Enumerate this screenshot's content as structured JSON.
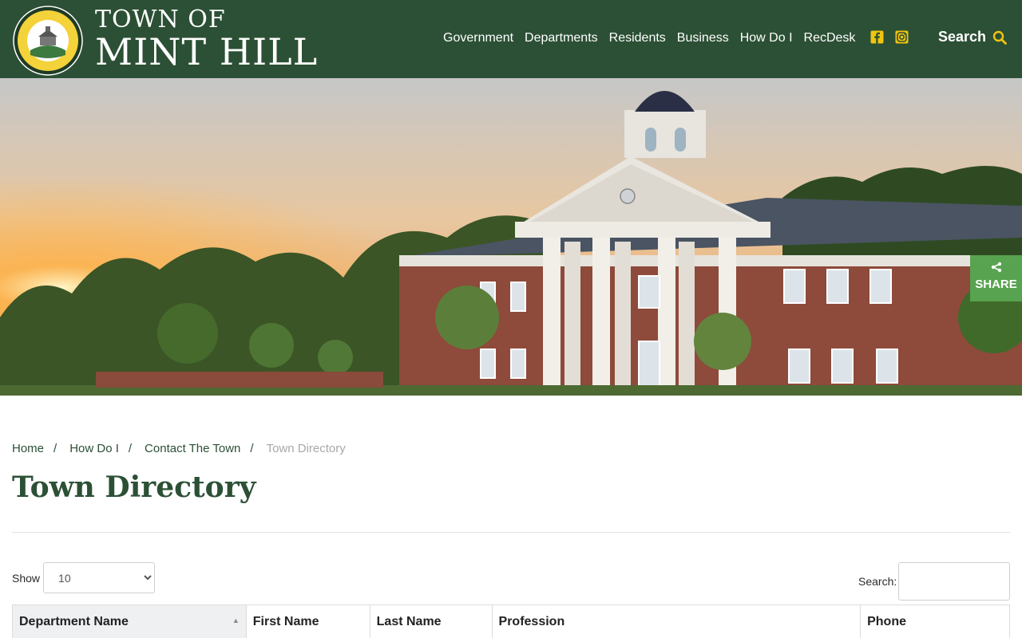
{
  "header": {
    "brand_line1": "TOWN OF",
    "brand_line2": "MINT HILL",
    "nav": [
      "Government",
      "Departments",
      "Residents",
      "Business",
      "How Do I",
      "RecDesk"
    ],
    "search_label": "Search",
    "social_icons": [
      "facebook-icon",
      "instagram-icon"
    ],
    "accent_color": "#f1c40f",
    "header_color": "#2c5035"
  },
  "share": {
    "label": "SHARE"
  },
  "breadcrumb": {
    "items": [
      "Home",
      "How Do I",
      "Contact The Town"
    ],
    "current": "Town Directory",
    "separator": "/"
  },
  "page": {
    "title": "Town Directory"
  },
  "table_controls": {
    "show_label": "Show",
    "show_value": "10",
    "search_label": "Search:"
  },
  "table": {
    "columns": [
      "Department Name",
      "First Name",
      "Last Name",
      "Profession",
      "Phone"
    ]
  }
}
